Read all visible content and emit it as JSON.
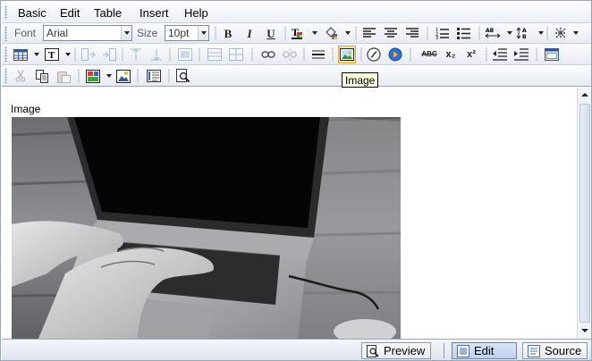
{
  "menu": {
    "items": [
      "Basic",
      "Edit",
      "Table",
      "Insert",
      "Help"
    ]
  },
  "toolbar": {
    "font_label": "Font",
    "font_value": "Arial",
    "size_label": "Size",
    "size_value": "10pt",
    "bold_label": "B",
    "italic_label": "I",
    "underline_label": "U",
    "strike_label": "ABC",
    "subscript_label": "x₂",
    "superscript_label": "x²"
  },
  "tooltip": {
    "text": "Image"
  },
  "content": {
    "caption": "Image"
  },
  "modes": {
    "preview_label": "Preview",
    "edit_label": "Edit",
    "source_label": "Source",
    "active": "Edit"
  },
  "colors": {
    "toolbar_border": "#9aa7bb",
    "active_highlight": "#ffe7a8",
    "tooltip_bg": "#ffffe1"
  }
}
